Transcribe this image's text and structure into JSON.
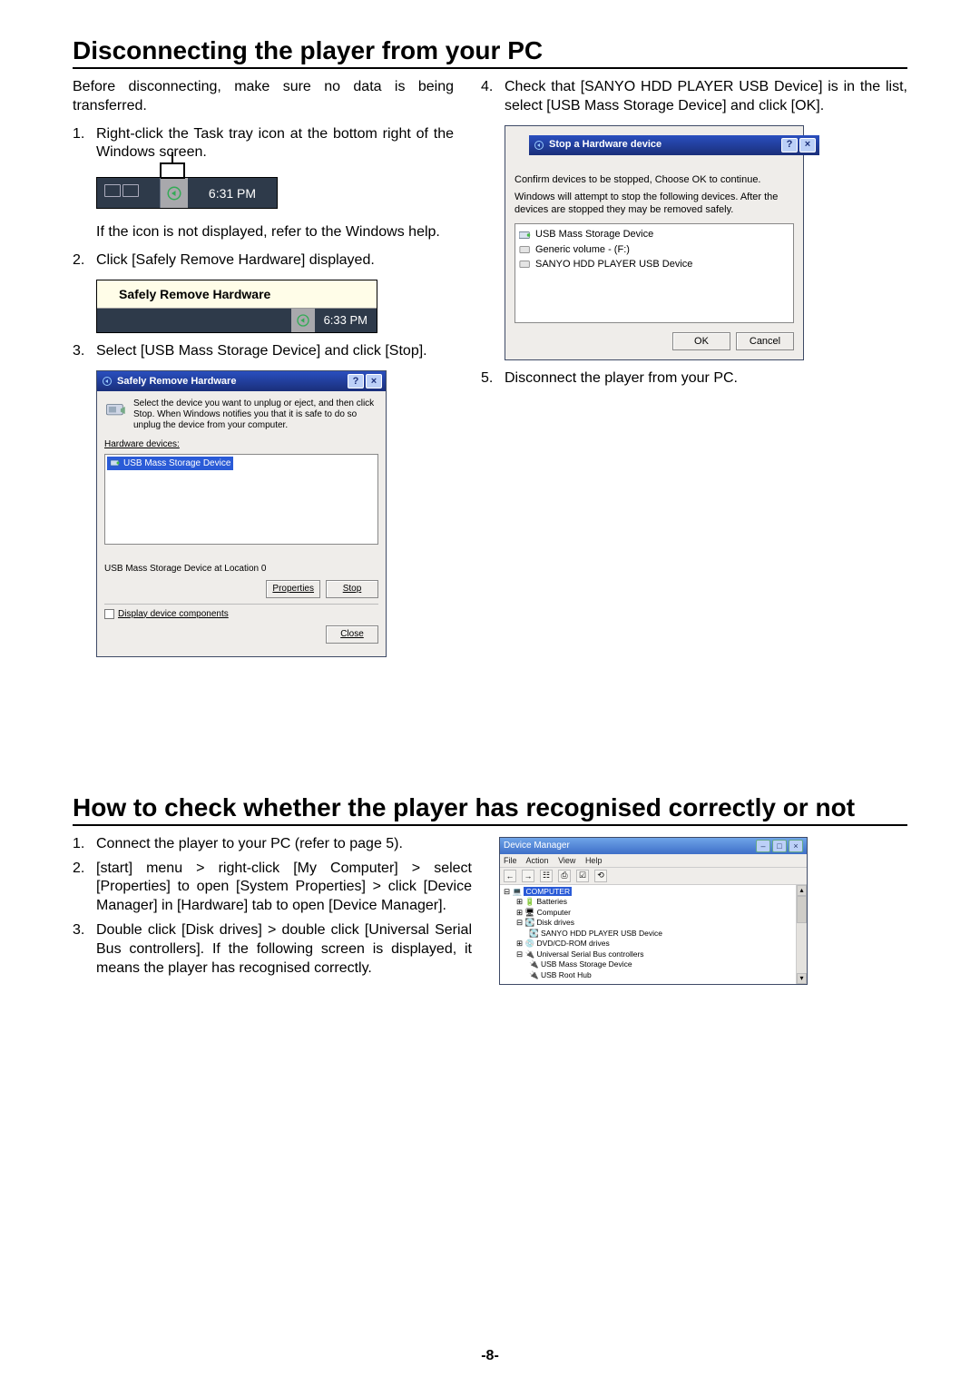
{
  "page_number": "-8-",
  "section1": {
    "title": "Disconnecting the player from your PC",
    "intro": "Before disconnecting, make sure no data is being transferred.",
    "steps_left": [
      {
        "num": "1.",
        "text": "Right-click the Task tray icon at the bottom right of the Windows screen."
      },
      {
        "num": "",
        "text": "If the icon is not displayed, refer to the Windows help."
      },
      {
        "num": "2.",
        "text": "Click [Safely Remove Hardware] displayed."
      },
      {
        "num": "3.",
        "text": "Select [USB Mass Storage Device] and click [Stop]."
      }
    ],
    "steps_right": [
      {
        "num": "4.",
        "text": "Check that [SANYO HDD PLAYER USB Device] is in the list, select [USB Mass Storage Device] and click [OK]."
      },
      {
        "num": "5.",
        "text": "Disconnect the player from your PC."
      }
    ],
    "tasktray_time": "6:31 PM",
    "tooltip": {
      "label": "Safely Remove Hardware",
      "time": "6:33 PM"
    },
    "srh_dialog": {
      "title": "Safely Remove Hardware",
      "help_btn": "?",
      "close_btn": "×",
      "desc": "Select the device you want to unplug or eject, and then click Stop. When Windows notifies you that it is safe to do so unplug the device from your computer.",
      "hw_label": "Hardware devices:",
      "list_item": "USB Mass Storage Device",
      "status": "USB Mass Storage Device at Location 0",
      "btn_properties": "Properties",
      "btn_stop": "Stop",
      "chk_label": "Display device components",
      "btn_close": "Close"
    },
    "stop_dialog": {
      "title": "Stop a Hardware device",
      "help_btn": "?",
      "close_btn": "×",
      "msg1": "Confirm devices to be stopped, Choose OK to continue.",
      "msg2": "Windows will attempt to stop the following devices. After the devices are stopped they may be removed safely.",
      "items": [
        "USB Mass Storage Device",
        "Generic volume - (F:)",
        "SANYO HDD PLAYER USB Device"
      ],
      "btn_ok": "OK",
      "btn_cancel": "Cancel"
    }
  },
  "section2": {
    "title": "How to check whether the player has recognised correctly or not",
    "steps": [
      {
        "num": "1.",
        "text": "Connect the player to your PC (refer to page 5)."
      },
      {
        "num": "2.",
        "text": "[start] menu > right-click [My Computer] > select [Properties] to open [System Properties] > click [Device Manager] in [Hardware] tab to open [Device Manager]."
      },
      {
        "num": "3.",
        "text": "Double click [Disk drives] > double click [Universal Serial Bus controllers]. If the following screen is displayed, it means the player has recognised correctly."
      }
    ],
    "devmgr": {
      "title": "Device Manager",
      "min_btn": "–",
      "max_btn": "□",
      "close_btn": "×",
      "menu": [
        "File",
        "Action",
        "View",
        "Help"
      ],
      "tree": {
        "root": "COMPUTER",
        "nodes": [
          {
            "lvl": 1,
            "sym": "⊞",
            "label": "Batteries"
          },
          {
            "lvl": 1,
            "sym": "⊞",
            "label": "Computer"
          },
          {
            "lvl": 1,
            "sym": "⊟",
            "label": "Disk drives"
          },
          {
            "lvl": 2,
            "sym": "",
            "label": "SANYO HDD PLAYER USB Device"
          },
          {
            "lvl": 1,
            "sym": "⊞",
            "label": "DVD/CD-ROM drives"
          },
          {
            "lvl": 1,
            "sym": "⊟",
            "label": "Universal Serial Bus controllers"
          },
          {
            "lvl": 2,
            "sym": "",
            "label": "USB Mass Storage Device"
          },
          {
            "lvl": 2,
            "sym": "",
            "label": "USB Root Hub"
          }
        ]
      }
    }
  }
}
